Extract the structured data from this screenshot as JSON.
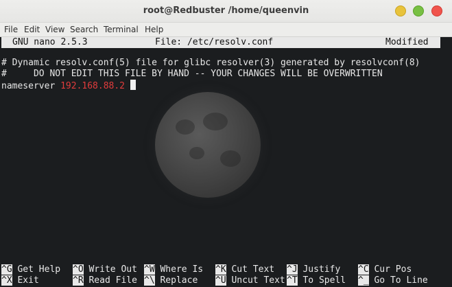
{
  "window": {
    "title": "root@Redbuster /home/queenvin"
  },
  "menu": [
    "File",
    "Edit",
    "View",
    "Search",
    "Terminal",
    "Help"
  ],
  "nano": {
    "version": "GNU nano 2.5.3",
    "file": "File: /etc/resolv.conf",
    "state": "Modified"
  },
  "content": {
    "line1": "# Dynamic resolv.conf(5) file for glibc resolver(3) generated by resolvconf(8)",
    "line2": "#     DO NOT EDIT THIS FILE BY HAND -- YOUR CHANGES WILL BE OVERWRITTEN",
    "line3_key": "nameserver ",
    "line3_value": "192.168.88.2"
  },
  "shortcuts": {
    "row1": [
      {
        "key": "^G",
        "label": " Get Help"
      },
      {
        "key": "^O",
        "label": " Write Out"
      },
      {
        "key": "^W",
        "label": " Where Is"
      },
      {
        "key": "^K",
        "label": " Cut Text"
      },
      {
        "key": "^J",
        "label": " Justify"
      },
      {
        "key": "^C",
        "label": " Cur Pos"
      }
    ],
    "row2": [
      {
        "key": "^X",
        "label": " Exit"
      },
      {
        "key": "^R",
        "label": " Read File"
      },
      {
        "key": "^\\",
        "label": " Replace"
      },
      {
        "key": "^U",
        "label": " Uncut Text"
      },
      {
        "key": "^T",
        "label": " To Spell"
      },
      {
        "key": "^_",
        "label": " Go To Line"
      }
    ]
  },
  "colors": {
    "ip": "#e23c3c",
    "background": "#1b1d1f"
  }
}
